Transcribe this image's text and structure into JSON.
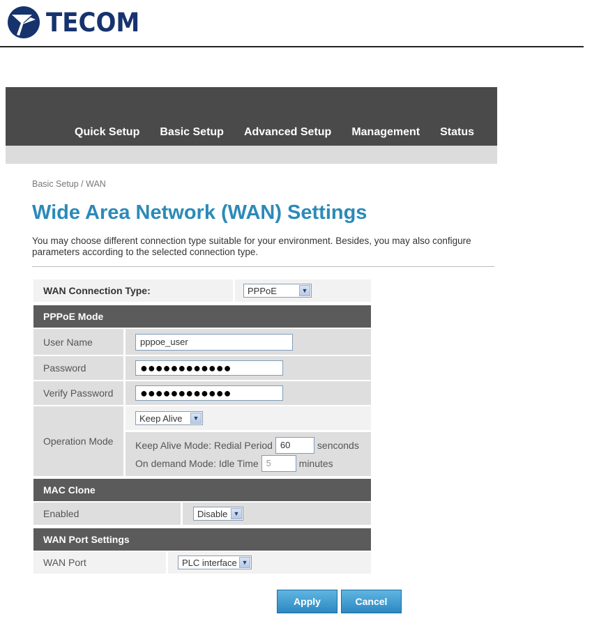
{
  "brand": {
    "name": "TECOM",
    "color": "#16336e"
  },
  "nav": {
    "items": [
      {
        "label": "Quick Setup"
      },
      {
        "label": "Basic Setup"
      },
      {
        "label": "Advanced Setup"
      },
      {
        "label": "Management"
      },
      {
        "label": "Status"
      }
    ]
  },
  "breadcrumb": "Basic Setup / WAN",
  "page": {
    "title": "Wide Area Network (WAN) Settings",
    "intro": "You may choose different connection type suitable for your environment. Besides, you may also configure parameters according to the selected connection type."
  },
  "wan_type": {
    "label": "WAN Connection Type:",
    "value": "PPPoE"
  },
  "pppoe": {
    "section_title": "PPPoE Mode",
    "username": {
      "label": "User Name",
      "value": "pppoe_user"
    },
    "password": {
      "label": "Password",
      "value": "●●●●●●●●●●●●"
    },
    "verify": {
      "label": "Verify Password",
      "value": "●●●●●●●●●●●●"
    },
    "operation": {
      "label": "Operation Mode",
      "mode_value": "Keep Alive",
      "keepalive_label": "Keep Alive Mode: Redial Period",
      "keepalive_value": "60",
      "keepalive_unit": "senconds",
      "ondemand_label": "On demand Mode: Idle Time",
      "ondemand_value": "5",
      "ondemand_unit": "minutes"
    }
  },
  "mac_clone": {
    "section_title": "MAC Clone",
    "enabled_label": "Enabled",
    "enabled_value": "Disable"
  },
  "wan_port": {
    "section_title": "WAN Port Settings",
    "label": "WAN Port",
    "value": "PLC interface"
  },
  "buttons": {
    "apply": "Apply",
    "cancel": "Cancel"
  }
}
